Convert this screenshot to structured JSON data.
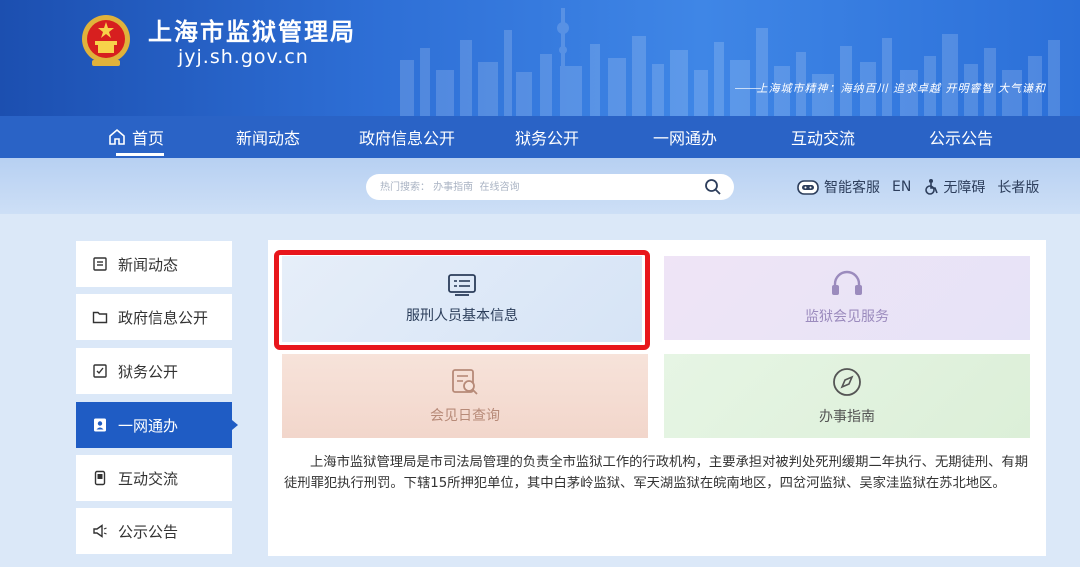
{
  "header": {
    "title": "上海市监狱管理局",
    "url": "jyj.sh.gov.cn",
    "slogan": "上海城市精神：海纳百川 追求卓越 开明睿智 大气谦和"
  },
  "nav": {
    "items": [
      {
        "label": "首页"
      },
      {
        "label": "新闻动态"
      },
      {
        "label": "政府信息公开"
      },
      {
        "label": "狱务公开"
      },
      {
        "label": "一网通办"
      },
      {
        "label": "互动交流"
      },
      {
        "label": "公示公告"
      }
    ]
  },
  "search": {
    "placeholder": "热门搜索： 办事指南  在线咨询"
  },
  "tools": {
    "assistant": "智能客服",
    "lang": "EN",
    "accessibility": "无障碍",
    "elder": "长者版"
  },
  "sidebar": {
    "items": [
      {
        "label": "新闻动态"
      },
      {
        "label": "政府信息公开"
      },
      {
        "label": "狱务公开"
      },
      {
        "label": "一网通办"
      },
      {
        "label": "互动交流"
      },
      {
        "label": "公示公告"
      }
    ],
    "active": "一网通办"
  },
  "cards": [
    {
      "label": "服刑人员基本信息",
      "icon": "id-card-icon"
    },
    {
      "label": "监狱会见服务",
      "icon": "headset-icon"
    },
    {
      "label": "会见日查询",
      "icon": "calendar-search-icon"
    },
    {
      "label": "办事指南",
      "icon": "compass-icon"
    }
  ],
  "description": "上海市监狱管理局是市司法局管理的负责全市监狱工作的行政机构，主要承担对被判处死刑缓期二年执行、无期徒刑、有期徒刑罪犯执行刑罚。下辖15所押犯单位，其中白茅岭监狱、军天湖监狱在皖南地区，四岔河监狱、吴家洼监狱在苏北地区。",
  "colors": {
    "primary": "#2a63c6",
    "highlight": "#e8161c"
  }
}
